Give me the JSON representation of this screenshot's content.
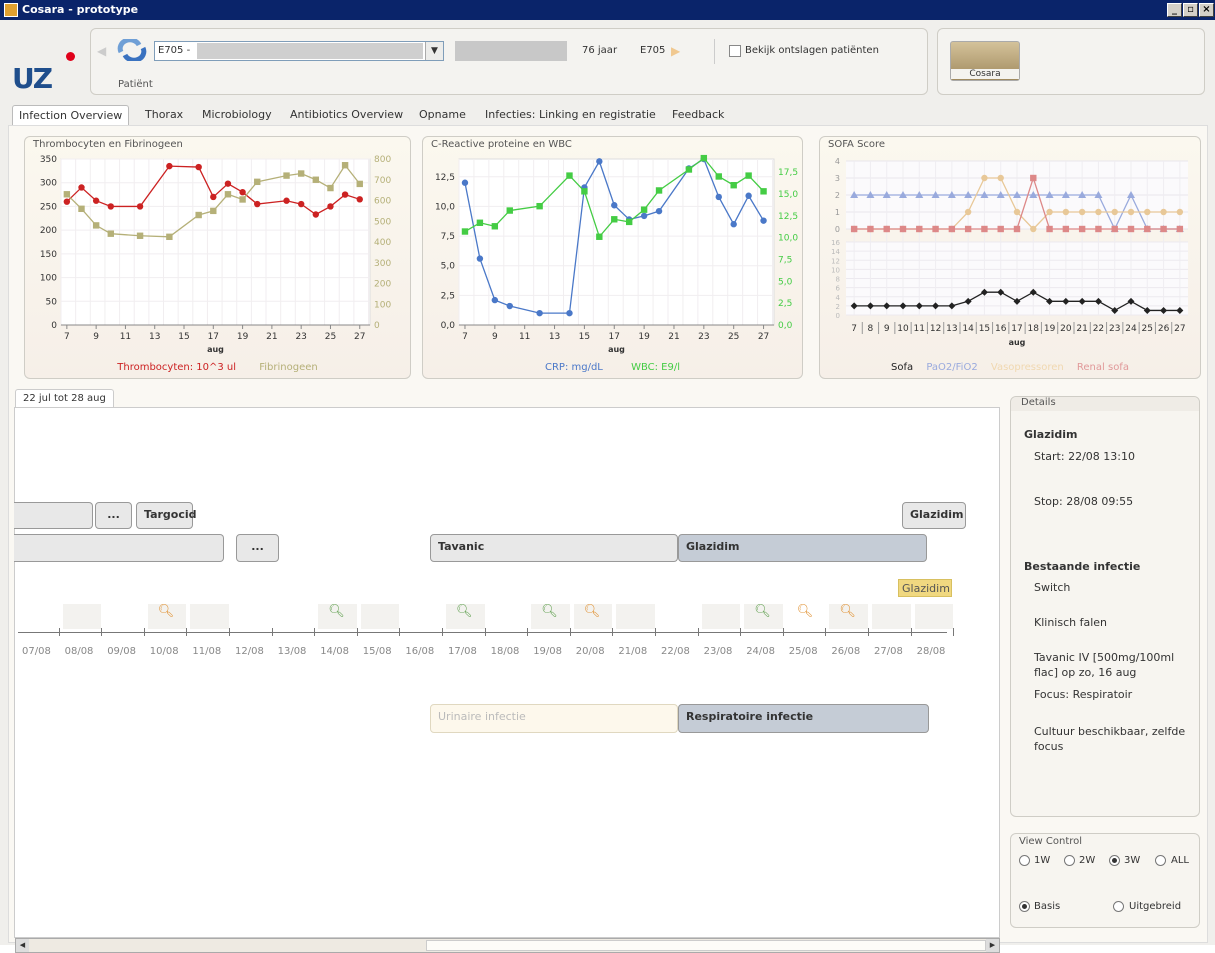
{
  "window": {
    "title": "Cosara - prototype"
  },
  "patient": {
    "label": "Patiënt",
    "combo_text": "E705 -",
    "age": "76 jaar",
    "id": "E705",
    "discharged_checkbox_label": "Bekijk ontslagen patiënten"
  },
  "cosara_button": "Cosara",
  "tabs": [
    "Infection Overview",
    "Thorax",
    "Microbiology",
    "Antibiotics Overview",
    "Opname",
    "Infecties: Linking en registratie",
    "Feedback"
  ],
  "charts": {
    "platelets": {
      "title": "Thrombocyten en Fibrinogeen",
      "legend1": "Thrombocyten: 10^3 ul",
      "legend2": "Fibrinogeen",
      "xlabel": "aug"
    },
    "crp": {
      "title": "C-Reactive proteine en WBC",
      "legend1": "CRP: mg/dL",
      "legend2": "WBC: E9/l",
      "xlabel": "aug"
    },
    "sofa": {
      "title": "SOFA Score",
      "legend1": "Sofa",
      "legend2": "PaO2/FiO2",
      "legend3": "Vasopressoren",
      "legend4": "Renal sofa",
      "xlabel": "aug"
    }
  },
  "chart_data": [
    {
      "type": "line",
      "title": "Thrombocyten en Fibrinogeen",
      "xlabel": "aug",
      "x_ticks": [
        "7",
        "9",
        "11",
        "13",
        "15",
        "17",
        "19",
        "21",
        "23",
        "25",
        "27"
      ],
      "ylim_left": [
        0,
        350
      ],
      "ylim_right": [
        0,
        800
      ],
      "series": [
        {
          "name": "Thrombocyten: 10^3 ul",
          "axis": "left",
          "color": "#cc2222",
          "marker": "circle",
          "x": [
            7,
            8,
            9,
            10,
            12,
            14,
            16,
            17,
            18,
            19,
            20,
            22,
            23,
            24,
            25,
            26,
            27
          ],
          "y": [
            260,
            290,
            262,
            250,
            250,
            335,
            333,
            270,
            298,
            280,
            255,
            262,
            255,
            233,
            250,
            275,
            265
          ]
        },
        {
          "name": "Fibrinogeen",
          "axis": "right",
          "color": "#b5b078",
          "marker": "square",
          "x": [
            7,
            8,
            9,
            10,
            12,
            14,
            16,
            17,
            18,
            19,
            20,
            22,
            23,
            24,
            25,
            26,
            27
          ],
          "y": [
            630,
            560,
            480,
            440,
            430,
            425,
            530,
            550,
            630,
            605,
            690,
            720,
            730,
            700,
            660,
            770,
            680
          ]
        }
      ]
    },
    {
      "type": "line",
      "title": "C-Reactive proteine en WBC",
      "xlabel": "aug",
      "x_ticks": [
        "7",
        "9",
        "11",
        "13",
        "15",
        "17",
        "19",
        "21",
        "23",
        "25",
        "27"
      ],
      "ylim_left": [
        0,
        14
      ],
      "ylim_right": [
        0,
        19
      ],
      "series": [
        {
          "name": "CRP: mg/dL",
          "axis": "left",
          "color": "#4a78c8",
          "marker": "circle",
          "x": [
            7,
            8,
            9,
            10,
            12,
            14,
            15,
            16,
            17,
            18,
            19,
            20,
            22,
            23,
            24,
            25,
            26,
            27
          ],
          "y": [
            12,
            5.6,
            2.1,
            1.6,
            1.0,
            1.0,
            11.6,
            13.8,
            10.1,
            8.9,
            9.2,
            9.6,
            13.2,
            14.0,
            10.8,
            8.5,
            10.9,
            8.8
          ]
        },
        {
          "name": "WBC: E9/l",
          "axis": "right",
          "color": "#44cc44",
          "marker": "square",
          "x": [
            7,
            8,
            9,
            10,
            12,
            14,
            15,
            16,
            17,
            18,
            19,
            20,
            22,
            23,
            24,
            25,
            26,
            27
          ],
          "y": [
            10.7,
            11.7,
            11.3,
            13.1,
            13.6,
            17.1,
            15.3,
            10.1,
            12.1,
            11.8,
            13.2,
            15.4,
            17.8,
            19.1,
            17.0,
            16.0,
            17.1,
            15.3
          ]
        }
      ]
    },
    {
      "type": "line",
      "title": "SOFA Score",
      "xlabel": "aug",
      "x_ticks": [
        "7",
        "8",
        "9",
        "10",
        "11",
        "12",
        "13",
        "14",
        "15",
        "16",
        "17",
        "18",
        "19",
        "20",
        "21",
        "22",
        "23",
        "24",
        "25",
        "26",
        "27"
      ],
      "ylim_top": [
        0,
        4
      ],
      "ylim_bottom": [
        0,
        16
      ],
      "series": [
        {
          "name": "PaO2/FiO2",
          "panel": "top",
          "color": "#99aadd",
          "marker": "triangle",
          "y": [
            2,
            2,
            2,
            2,
            2,
            2,
            2,
            2,
            2,
            2,
            2,
            2,
            2,
            2,
            2,
            2,
            0,
            2,
            0,
            0,
            0
          ]
        },
        {
          "name": "Vasopressoren",
          "panel": "top",
          "color": "#e8c898",
          "marker": "circle",
          "y": [
            0,
            0,
            0,
            0,
            0,
            0,
            0,
            1,
            3,
            3,
            1,
            0,
            1,
            1,
            1,
            1,
            1,
            1,
            1,
            1,
            1
          ]
        },
        {
          "name": "Renal sofa",
          "panel": "top",
          "color": "#dd8888",
          "marker": "square",
          "y": [
            0,
            0,
            0,
            0,
            0,
            0,
            0,
            0,
            0,
            0,
            0,
            3,
            0,
            0,
            0,
            0,
            0,
            0,
            0,
            0,
            0
          ]
        },
        {
          "name": "Sofa",
          "panel": "bottom",
          "color": "#222222",
          "marker": "diamond",
          "y": [
            2,
            2,
            2,
            2,
            2,
            2,
            2,
            3,
            5,
            5,
            3,
            5,
            3,
            3,
            3,
            3,
            1,
            3,
            1,
            1,
            1
          ]
        }
      ]
    }
  ],
  "timeline": {
    "tab_label": "22 jul tot 28 aug",
    "bars": [
      {
        "label": "",
        "style": "normal"
      },
      {
        "label": "...",
        "style": "normal"
      },
      {
        "label": "Targocid",
        "style": "normal"
      },
      {
        "label": "Glazidim",
        "style": "normal"
      },
      {
        "label": "",
        "style": "normal"
      },
      {
        "label": "...",
        "style": "normal"
      },
      {
        "label": "Tavanic",
        "style": "normal"
      },
      {
        "label": "Glazidim",
        "style": "dark"
      }
    ],
    "highlight_label": "Glazidim",
    "dates": [
      "07/08",
      "08/08",
      "09/08",
      "10/08",
      "11/08",
      "12/08",
      "13/08",
      "14/08",
      "15/08",
      "16/08",
      "17/08",
      "18/08",
      "19/08",
      "20/08",
      "21/08",
      "22/08",
      "23/08",
      "24/08",
      "25/08",
      "26/08",
      "27/08",
      "28/08"
    ],
    "infections": [
      {
        "label": "Urinaire infectie",
        "style": "light"
      },
      {
        "label": "Respiratoire infectie",
        "style": "dark"
      }
    ]
  },
  "details": {
    "header": "Details",
    "drug": "Glazidim",
    "start": "Start: 22/08 13:10",
    "stop": "Stop: 28/08 09:55",
    "infection_title": "Bestaande infectie",
    "lines": [
      "Switch",
      "Klinisch falen",
      "Tavanic IV [500mg/100ml flac] op zo, 16 aug",
      "Focus: Respiratoir",
      "Cultuur beschikbaar, zelfde focus"
    ]
  },
  "view_control": {
    "header": "View Control",
    "range_options": [
      "1W",
      "2W",
      "3W",
      "ALL"
    ],
    "selected_range": "3W",
    "mode_options": [
      "Basis",
      "Uitgebreid"
    ],
    "selected_mode": "Basis"
  }
}
